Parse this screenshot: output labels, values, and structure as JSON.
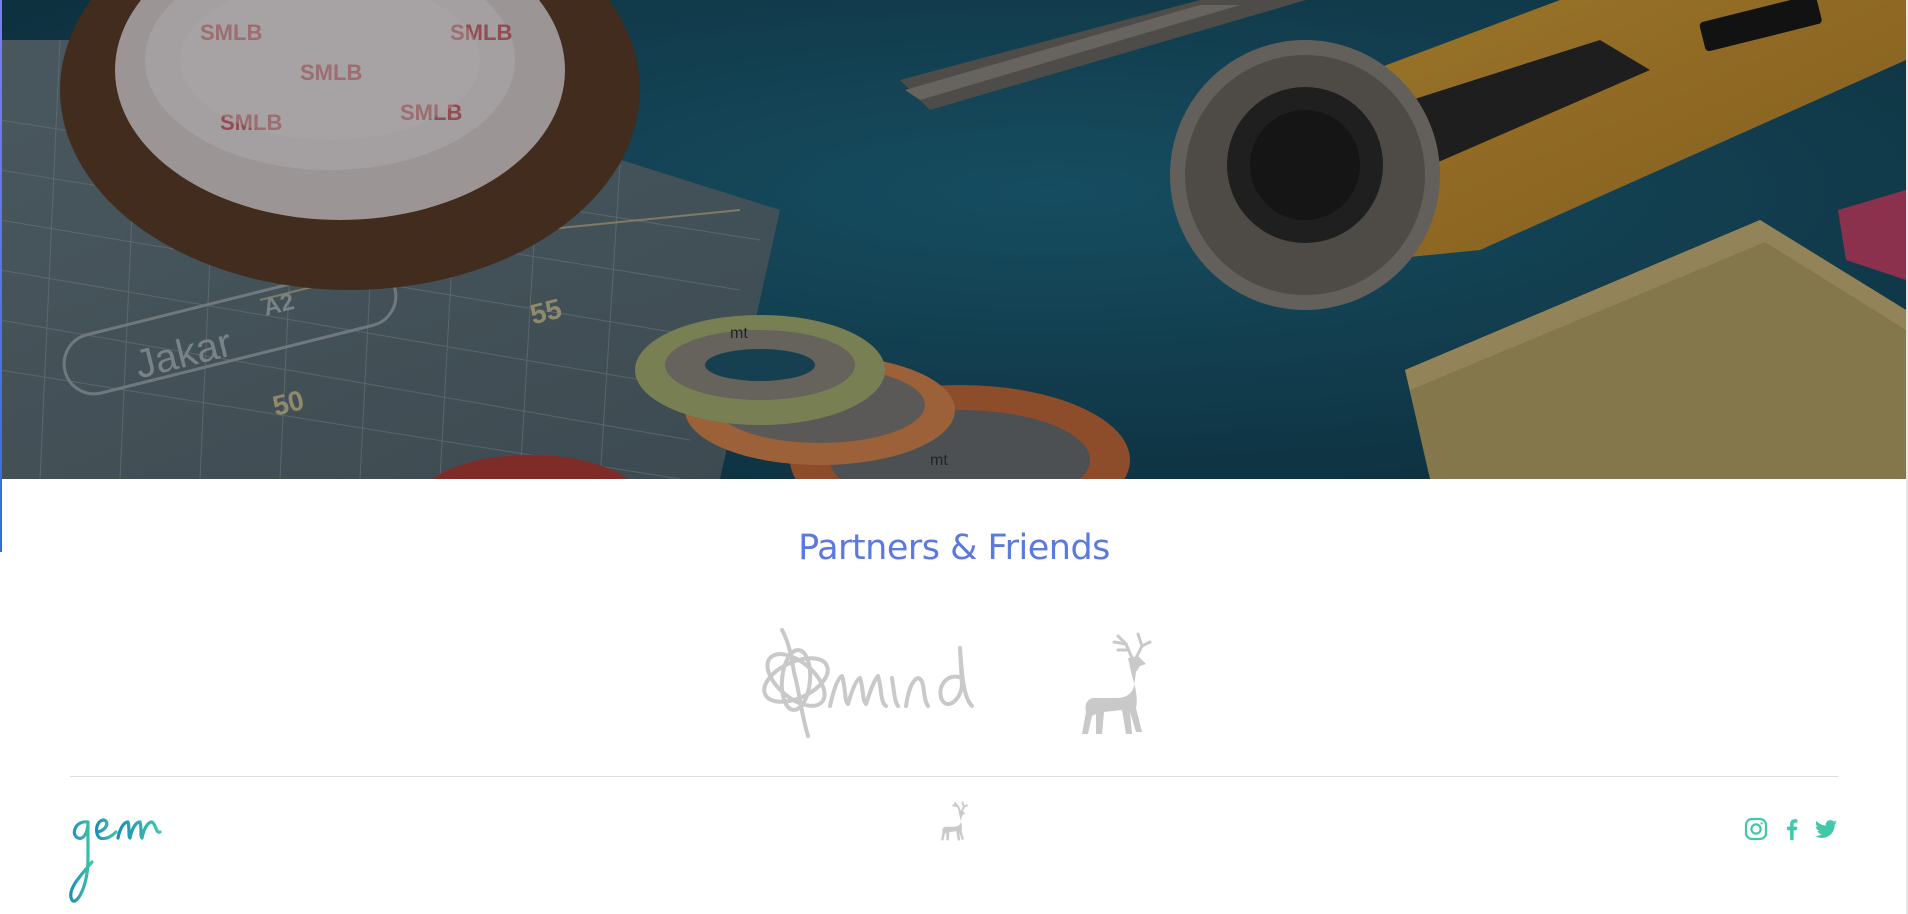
{
  "hero": {
    "tape_print": "SMLB",
    "mat_brand": "Jakar",
    "mat_size": "A2",
    "ruler_numbers": [
      "50",
      "55"
    ],
    "washi_print": "mt"
  },
  "partners": {
    "title": "Partners & Friends",
    "logos": [
      {
        "name": "mind",
        "icon": "mind-logo"
      },
      {
        "name": "deer",
        "icon": "deer-logo"
      }
    ]
  },
  "footer": {
    "brand": "gem",
    "social": [
      "instagram-icon",
      "facebook-icon",
      "twitter-icon"
    ]
  },
  "colors": {
    "accent": "#5b79e0",
    "social": "#40c9a9",
    "logo_grey": "#c9c9c9",
    "hero_bg": "#1c4f66"
  }
}
